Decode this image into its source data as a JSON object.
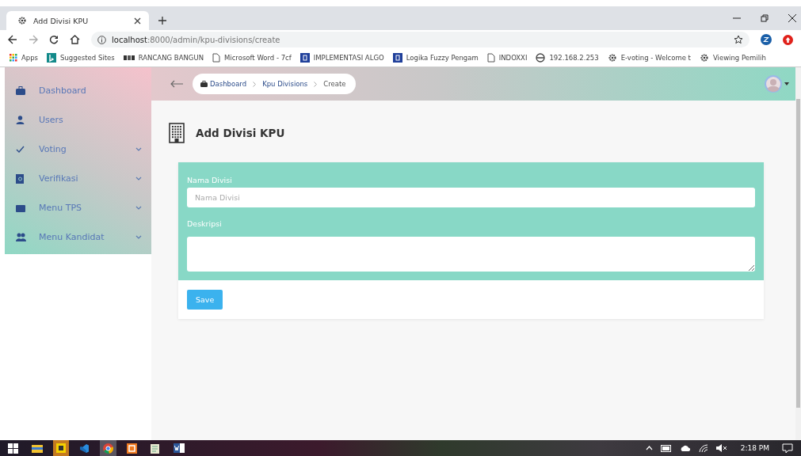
{
  "browser": {
    "tab_title": "Add Divisi KPU",
    "url_host": "localhost",
    "url_path": ":8000/admin/kpu-divisions/create"
  },
  "bookmarks": [
    {
      "label": "Apps",
      "kind": "apps"
    },
    {
      "label": "Suggested Sites",
      "kind": "bing"
    },
    {
      "label": "RANCANG BANGUN",
      "kind": "pkp"
    },
    {
      "label": "Microsoft Word - 7cf",
      "kind": "page"
    },
    {
      "label": "IMPLEMENTASI ALGO",
      "kind": "d"
    },
    {
      "label": "Logika Fuzzy Pengam",
      "kind": "d"
    },
    {
      "label": "INDOXXI",
      "kind": "page"
    },
    {
      "label": "192.168.2.253",
      "kind": "globe"
    },
    {
      "label": "E-voting - Welcome t",
      "kind": "gear"
    },
    {
      "label": "Viewing Pemilih",
      "kind": "gear"
    }
  ],
  "sidebar": {
    "items": [
      {
        "label": "Dashboard",
        "kind": "case",
        "has_submenu": false
      },
      {
        "label": "Users",
        "kind": "user",
        "has_submenu": false
      },
      {
        "label": "Voting",
        "kind": "check",
        "has_submenu": true
      },
      {
        "label": "Verifikasi",
        "kind": "book",
        "has_submenu": true
      },
      {
        "label": "Menu TPS",
        "kind": "box",
        "has_submenu": true
      },
      {
        "label": "Menu Kandidat",
        "kind": "users",
        "has_submenu": true
      }
    ]
  },
  "breadcrumb": [
    "Dashboard",
    "Kpu Divisions",
    "Create"
  ],
  "page_title": "Add Divisi KPU",
  "form": {
    "fields": [
      {
        "label": "Nama Divisi",
        "kind": "input",
        "placeholder": "Nama Divisi"
      },
      {
        "label": "Deskripsi",
        "kind": "textarea"
      }
    ],
    "submit": "Save"
  },
  "taskbar": {
    "time": "2:18 PM"
  }
}
